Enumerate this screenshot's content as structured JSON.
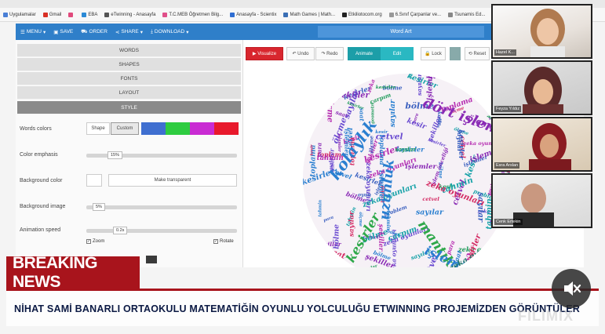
{
  "bookmarks": [
    {
      "label": "Uygulamalar",
      "color": "#4a7fd6"
    },
    {
      "label": "Gmail",
      "color": "#d93025"
    },
    {
      "label": "",
      "color": "#e04a7c"
    },
    {
      "label": "EBA",
      "color": "#2b8ad6"
    },
    {
      "label": "eTwinning - Anasayfa",
      "color": "#555555"
    },
    {
      "label": "T.C.MEB Öğretmen Bilg...",
      "color": "#e0508a"
    },
    {
      "label": "Anasayfa - Scientix",
      "color": "#2f6ed2"
    },
    {
      "label": "Math Games | Math...",
      "color": "#3a6fb5"
    },
    {
      "label": "Etkiliotocom.org",
      "color": "#222222"
    },
    {
      "label": "6.Sınıf Çarpanlar ve...",
      "color": "#999999"
    },
    {
      "label": "Tsunamis Ed...",
      "color": "#888888"
    }
  ],
  "toolbar": {
    "menu": "MENU",
    "save": "SAVE",
    "order": "ORDER",
    "share": "SHARE",
    "download": "DOWNLOAD",
    "title": "Word Art"
  },
  "accordion": [
    "WORDS",
    "SHAPES",
    "FONTS",
    "LAYOUT",
    "STYLE"
  ],
  "style": {
    "words_colors_label": "Words colors",
    "shape_option": "Shape",
    "custom_option": "Custom",
    "custom_colors": [
      "#3f6fd0",
      "#2ecc40",
      "#c92bd3",
      "#e8192c"
    ],
    "color_emphasis_label": "Color emphasis",
    "color_emphasis_value": "15%",
    "background_color_label": "Background color",
    "make_transparent": "Make transparent",
    "background_image_label": "Background image",
    "background_image_value": "5%",
    "animation_speed_label": "Animation speed",
    "animation_speed_value": "0.2s",
    "zoom_label": "Zoom",
    "rotate_label": "Rotate"
  },
  "stage": {
    "visualize": "Visualize",
    "undo": "Undo",
    "redo": "Redo",
    "animate": "Animate",
    "edit": "Edit",
    "lock": "Lock",
    "reset": "Reset"
  },
  "wordcloud": [
    "dört işlem",
    "kolaylık",
    "uzunluk",
    "mantık",
    "işlemler",
    "kesirler",
    "zeka oyunları",
    "problem",
    "cetvel",
    "işlem önceliği",
    "tahmin",
    "oyun",
    "sayılar",
    "çarpım",
    "bölme",
    "toplama",
    "saat",
    "kesir",
    "ölçme",
    "geometri",
    "para",
    "şekiller"
  ],
  "participants": [
    {
      "name": "Hazel K..."
    },
    {
      "name": "Feyza Yıldız"
    },
    {
      "name": "Esra Arslan"
    },
    {
      "name": "Cenk Ertekin"
    }
  ],
  "news": {
    "breaking": "BREAKING NEWS",
    "ticker": "NİHAT SAMİ BANARLI ORTAOKULU  MATEMATİĞİN OYUNLU YOLCULUĞU ETWINNING PROJEMİZDEN GÖRÜNTÜLER",
    "watermark": "FILIMIX"
  }
}
